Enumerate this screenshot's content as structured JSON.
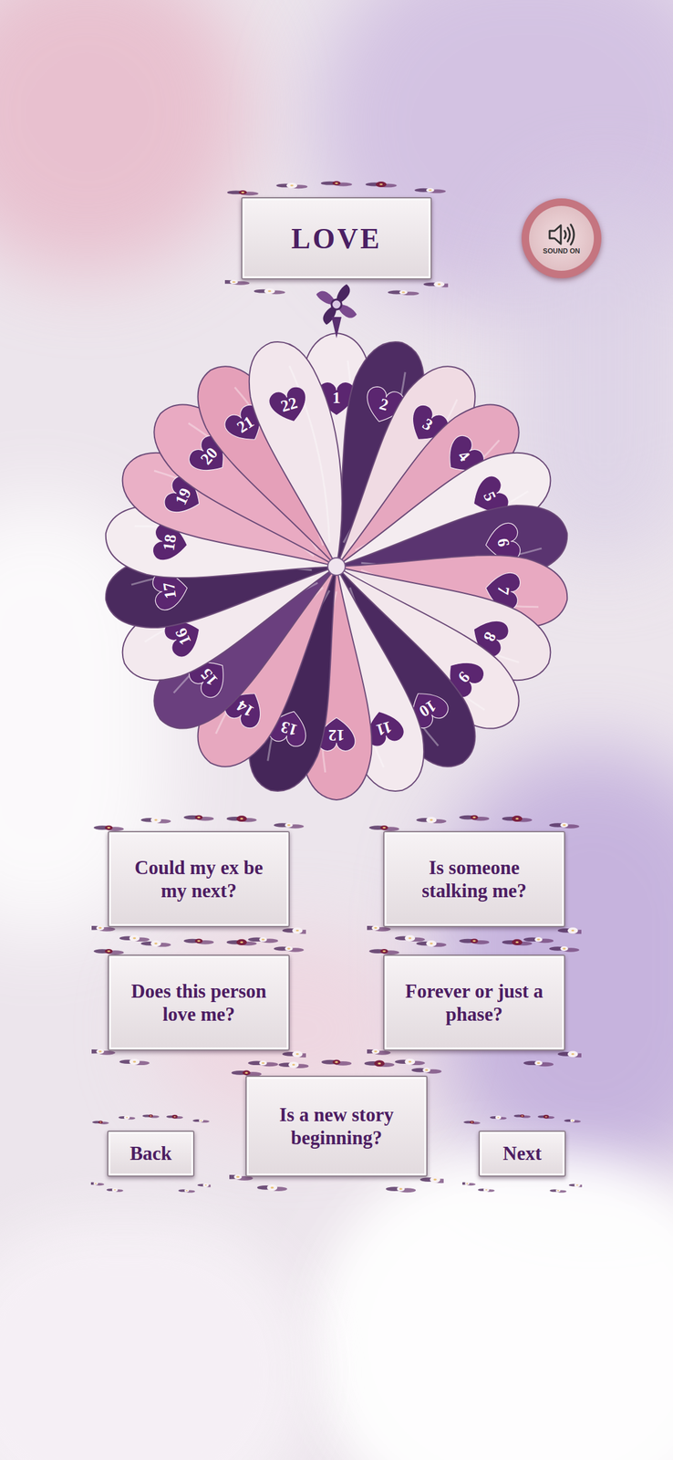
{
  "title": "LOVE",
  "sound": {
    "label": "SOUND ON",
    "on": true
  },
  "wheel": {
    "cards": [
      {
        "number": "1"
      },
      {
        "number": "2"
      },
      {
        "number": "3"
      },
      {
        "number": "4"
      },
      {
        "number": "5"
      },
      {
        "number": "6"
      },
      {
        "number": "7"
      },
      {
        "number": "8"
      },
      {
        "number": "9"
      },
      {
        "number": "10"
      },
      {
        "number": "11"
      },
      {
        "number": "12"
      },
      {
        "number": "13"
      },
      {
        "number": "14"
      },
      {
        "number": "15"
      },
      {
        "number": "16"
      },
      {
        "number": "17"
      },
      {
        "number": "18"
      },
      {
        "number": "19"
      },
      {
        "number": "20"
      },
      {
        "number": "21"
      },
      {
        "number": "22"
      }
    ]
  },
  "questions": [
    "Could my ex be my next?",
    "Is someone stalking me?",
    "Does this person love me?",
    "Forever or just a phase?",
    "Is a new story beginning?"
  ],
  "nav": {
    "back": "Back",
    "next": "Next"
  }
}
